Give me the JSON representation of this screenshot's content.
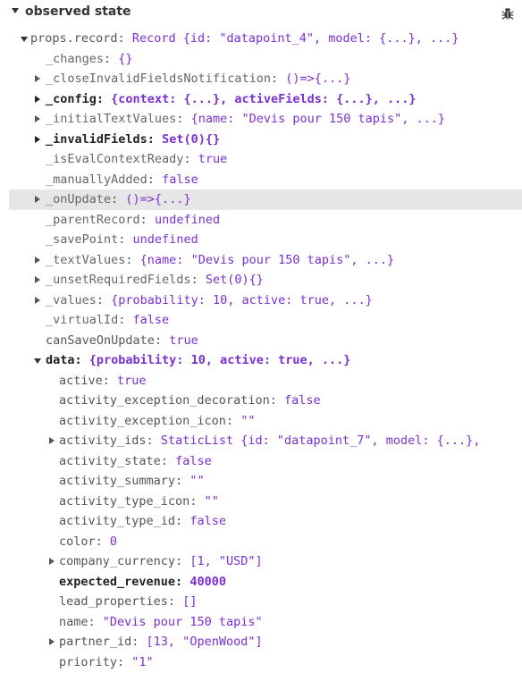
{
  "panel": {
    "title": "observed state"
  },
  "rows": [
    {
      "indent": 0,
      "toggle": "open",
      "key": "props.record",
      "style": "plain",
      "value": "Record {id: \"datapoint_4\", model: {...}, ...}"
    },
    {
      "indent": 1,
      "toggle": "none",
      "key": "_changes",
      "style": "plain",
      "value": "{}"
    },
    {
      "indent": 1,
      "toggle": "closed",
      "key": "_closeInvalidFieldsNotification",
      "style": "plain",
      "value": "()=>{...}"
    },
    {
      "indent": 1,
      "toggle": "closed",
      "key": "_config",
      "style": "bold",
      "value": "{context: {...}, activeFields: {...}, ...}"
    },
    {
      "indent": 1,
      "toggle": "closed",
      "key": "_initialTextValues",
      "style": "plain",
      "value": "{name: \"Devis pour 150 tapis\", ...}"
    },
    {
      "indent": 1,
      "toggle": "closed",
      "key": "_invalidFields",
      "style": "bold",
      "value": "Set(0){}"
    },
    {
      "indent": 1,
      "toggle": "none",
      "key": "_isEvalContextReady",
      "style": "plain",
      "value": "true"
    },
    {
      "indent": 1,
      "toggle": "none",
      "key": "_manuallyAdded",
      "style": "plain",
      "value": "false"
    },
    {
      "indent": 1,
      "toggle": "closed",
      "key": "_onUpdate",
      "style": "plain",
      "value": "()=>{...}",
      "highlight": true
    },
    {
      "indent": 1,
      "toggle": "none",
      "key": "_parentRecord",
      "style": "plain",
      "value": "undefined"
    },
    {
      "indent": 1,
      "toggle": "none",
      "key": "_savePoint",
      "style": "plain",
      "value": "undefined"
    },
    {
      "indent": 1,
      "toggle": "closed",
      "key": "_textValues",
      "style": "plain",
      "value": "{name: \"Devis pour 150 tapis\", ...}"
    },
    {
      "indent": 1,
      "toggle": "closed",
      "key": "_unsetRequiredFields",
      "style": "plain",
      "value": "Set(0){}"
    },
    {
      "indent": 1,
      "toggle": "closed",
      "key": "_values",
      "style": "plain",
      "value": "{probability: 10, active: true, ...}"
    },
    {
      "indent": 1,
      "toggle": "none",
      "key": "_virtualId",
      "style": "plain",
      "value": "false"
    },
    {
      "indent": 1,
      "toggle": "none",
      "key": "canSaveOnUpdate",
      "style": "plain",
      "value": "true"
    },
    {
      "indent": 1,
      "toggle": "open",
      "key": "data",
      "style": "bold",
      "value": "{probability: 10, active: true, ...}"
    },
    {
      "indent": 2,
      "toggle": "none",
      "key": "active",
      "style": "plain",
      "value": "true"
    },
    {
      "indent": 2,
      "toggle": "none",
      "key": "activity_exception_decoration",
      "style": "plain",
      "value": "false"
    },
    {
      "indent": 2,
      "toggle": "none",
      "key": "activity_exception_icon",
      "style": "plain",
      "value": "\"\""
    },
    {
      "indent": 2,
      "toggle": "closed",
      "key": "activity_ids",
      "style": "plain",
      "value": "StaticList {id: \"datapoint_7\", model: {...},"
    },
    {
      "indent": 2,
      "toggle": "none",
      "key": "activity_state",
      "style": "plain",
      "value": "false"
    },
    {
      "indent": 2,
      "toggle": "none",
      "key": "activity_summary",
      "style": "plain",
      "value": "\"\""
    },
    {
      "indent": 2,
      "toggle": "none",
      "key": "activity_type_icon",
      "style": "plain",
      "value": "\"\""
    },
    {
      "indent": 2,
      "toggle": "none",
      "key": "activity_type_id",
      "style": "plain",
      "value": "false"
    },
    {
      "indent": 2,
      "toggle": "none",
      "key": "color",
      "style": "plain",
      "value": "0"
    },
    {
      "indent": 2,
      "toggle": "closed",
      "key": "company_currency",
      "style": "plain",
      "value": "[1, \"USD\"]"
    },
    {
      "indent": 2,
      "toggle": "none",
      "key": "expected_revenue",
      "style": "bold",
      "value": "40000"
    },
    {
      "indent": 2,
      "toggle": "none",
      "key": "lead_properties",
      "style": "plain",
      "value": "[]"
    },
    {
      "indent": 2,
      "toggle": "none",
      "key": "name",
      "style": "plain",
      "value": "\"Devis pour 150 tapis\""
    },
    {
      "indent": 2,
      "toggle": "closed",
      "key": "partner_id",
      "style": "plain",
      "value": "[13, \"OpenWood\"]"
    },
    {
      "indent": 2,
      "toggle": "none",
      "key": "priority",
      "style": "plain",
      "value": "\"1\""
    }
  ]
}
